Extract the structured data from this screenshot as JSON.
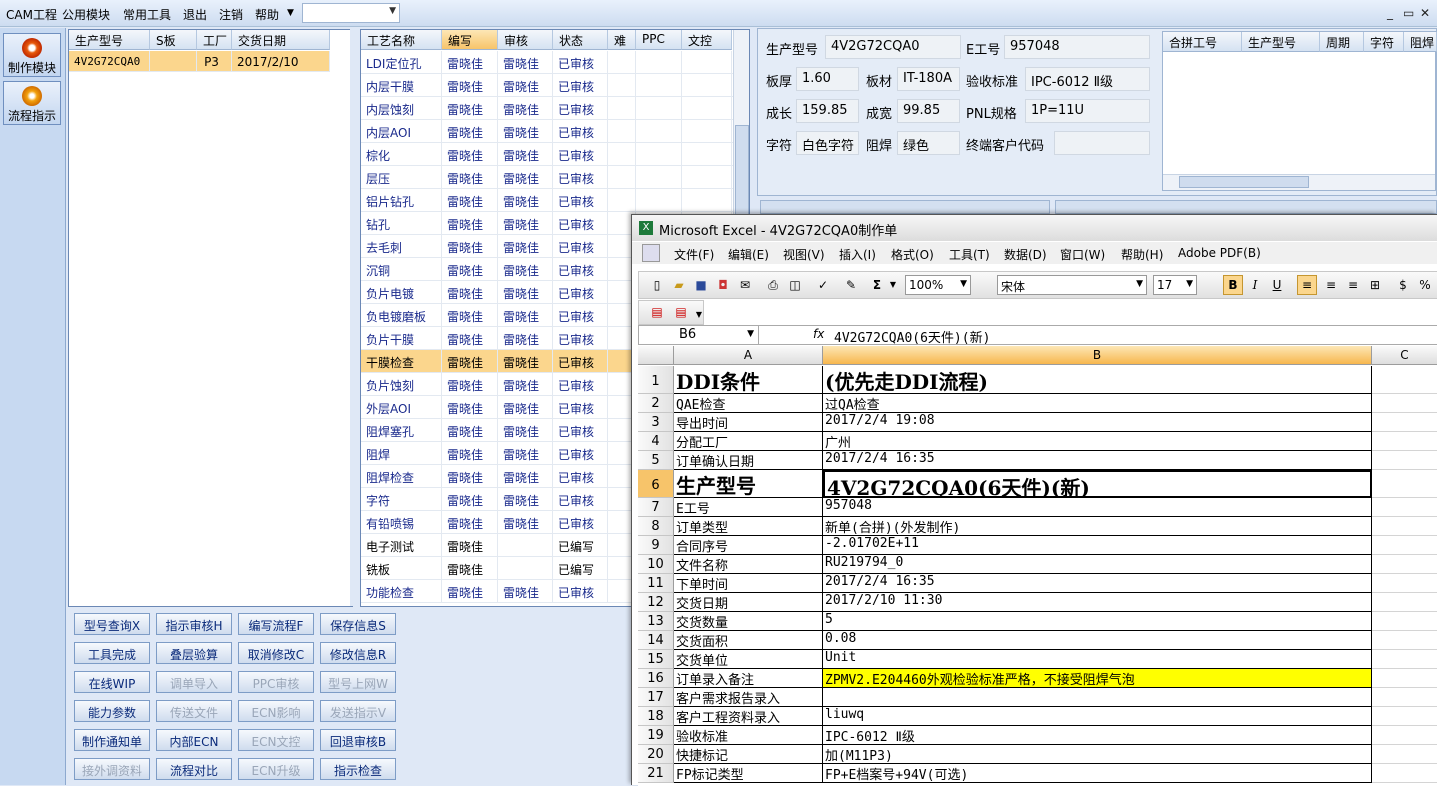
{
  "menu": {
    "items": [
      "CAM工程",
      "公用模块",
      "常用工具",
      "退出",
      "注销",
      "帮助"
    ],
    "win_controls": [
      "_",
      "▭",
      "✕"
    ]
  },
  "nav": {
    "items": [
      {
        "label": "制作模块",
        "icon": "flame-icon"
      },
      {
        "label": "流程指示",
        "icon": "flow-icon"
      }
    ]
  },
  "orders": {
    "headers": [
      "生产型号",
      "S板",
      "工厂",
      "交货日期"
    ],
    "rows": [
      [
        "4V2G72CQA0",
        "",
        "P3",
        "2017/2/10"
      ]
    ]
  },
  "process": {
    "headers": [
      "工艺名称",
      "编写",
      "审核",
      "状态",
      "难",
      "PPC",
      "文控"
    ],
    "rows": [
      [
        "LDI定位孔",
        "雷晓佳",
        "雷晓佳",
        "已审核"
      ],
      [
        "内层干膜",
        "雷晓佳",
        "雷晓佳",
        "已审核"
      ],
      [
        "内层蚀刻",
        "雷晓佳",
        "雷晓佳",
        "已审核"
      ],
      [
        "内层AOI",
        "雷晓佳",
        "雷晓佳",
        "已审核"
      ],
      [
        "棕化",
        "雷晓佳",
        "雷晓佳",
        "已审核"
      ],
      [
        "层压",
        "雷晓佳",
        "雷晓佳",
        "已审核"
      ],
      [
        "铝片钻孔",
        "雷晓佳",
        "雷晓佳",
        "已审核"
      ],
      [
        "钻孔",
        "雷晓佳",
        "雷晓佳",
        "已审核"
      ],
      [
        "去毛刺",
        "雷晓佳",
        "雷晓佳",
        "已审核"
      ],
      [
        "沉铜",
        "雷晓佳",
        "雷晓佳",
        "已审核"
      ],
      [
        "负片电镀",
        "雷晓佳",
        "雷晓佳",
        "已审核"
      ],
      [
        "负电镀磨板",
        "雷晓佳",
        "雷晓佳",
        "已审核"
      ],
      [
        "负片干膜",
        "雷晓佳",
        "雷晓佳",
        "已审核"
      ],
      [
        "干膜检查",
        "雷晓佳",
        "雷晓佳",
        "已审核"
      ],
      [
        "负片蚀刻",
        "雷晓佳",
        "雷晓佳",
        "已审核"
      ],
      [
        "外层AOI",
        "雷晓佳",
        "雷晓佳",
        "已审核"
      ],
      [
        "阻焊塞孔",
        "雷晓佳",
        "雷晓佳",
        "已审核"
      ],
      [
        "阻焊",
        "雷晓佳",
        "雷晓佳",
        "已审核"
      ],
      [
        "阻焊检查",
        "雷晓佳",
        "雷晓佳",
        "已审核"
      ],
      [
        "字符",
        "雷晓佳",
        "雷晓佳",
        "已审核"
      ],
      [
        "有铅喷锡",
        "雷晓佳",
        "雷晓佳",
        "已审核"
      ],
      [
        "电子测试",
        "雷晓佳",
        "",
        "已编写"
      ],
      [
        "铣板",
        "雷晓佳",
        "",
        "已编写"
      ],
      [
        "功能检查",
        "雷晓佳",
        "雷晓佳",
        "已审核"
      ]
    ]
  },
  "buttons": [
    [
      "型号查询X",
      "指示审核H",
      "编写流程F",
      "保存信息S"
    ],
    [
      "工具完成",
      "叠层验算",
      "取消修改C",
      "修改信息R"
    ],
    [
      "在线WIP",
      "调单导入",
      "PPC审核",
      "型号上网W"
    ],
    [
      "能力参数",
      "传送文件",
      "ECN影响",
      "发送指示V"
    ],
    [
      "制作通知单",
      "内部ECN",
      "ECN文控",
      "回退审核B"
    ],
    [
      "接外调资料",
      "流程对比",
      "ECN升级",
      "指示检查"
    ]
  ],
  "info": {
    "model_label": "生产型号",
    "model": "4V2G72CQA0",
    "e_label": "E工号",
    "e_no": "957048",
    "thick_label": "板厚",
    "thick": "1.60",
    "mat_label": "板材",
    "mat": "IT-180A",
    "std_label": "验收标准",
    "std": "IPC-6012 Ⅱ级",
    "len_label": "成长",
    "len": "159.85",
    "wid_label": "成宽",
    "wid": "99.85",
    "pnl_label": "PNL规格",
    "pnl": "1P=11U",
    "char_label": "字符",
    "char": "白色字符",
    "mask_label": "阻焊",
    "mask": "绿色",
    "cust_label": "终端客户代码",
    "cust": "",
    "merge_headers": [
      "合拼工号",
      "生产型号",
      "周期",
      "字符",
      "阻焊"
    ]
  },
  "excel": {
    "title": "Microsoft Excel - 4V2G72CQA0制作单",
    "menu": [
      "文件(F)",
      "编辑(E)",
      "视图(V)",
      "插入(I)",
      "格式(O)",
      "工具(T)",
      "数据(D)",
      "窗口(W)",
      "帮助(H)",
      "Adobe PDF(B)"
    ],
    "zoom": "100%",
    "font": "宋体",
    "size": "17",
    "namebox": "B6",
    "formula": "4V2G72CQA0(6天件)(新)",
    "cols": [
      "A",
      "B",
      "C"
    ],
    "rows": [
      [
        "1",
        "DDI条件",
        "(优先走DDI流程)"
      ],
      [
        "2",
        "QAE检查",
        "过QA检查"
      ],
      [
        "3",
        "导出时间",
        "2017/2/4 19:08"
      ],
      [
        "4",
        "分配工厂",
        "广州"
      ],
      [
        "5",
        "订单确认日期",
        "2017/2/4 16:35"
      ],
      [
        "6",
        "生产型号",
        "4V2G72CQA0(6天件)(新)"
      ],
      [
        "7",
        "E工号",
        "957048"
      ],
      [
        "8",
        "订单类型",
        "新单(合拼)(外发制作)"
      ],
      [
        "9",
        "合同序号",
        "-2.01702E+11"
      ],
      [
        "10",
        "文件名称",
        "RU219794_0"
      ],
      [
        "11",
        "下单时间",
        "2017/2/4 16:35"
      ],
      [
        "12",
        "交货日期",
        "2017/2/10 11:30"
      ],
      [
        "13",
        "交货数量",
        "5"
      ],
      [
        "14",
        "交货面积",
        "0.08"
      ],
      [
        "15",
        "交货单位",
        "Unit"
      ],
      [
        "16",
        "订单录入备注",
        "ZPMV2.E204460外观检验标准严格，不接受阻焊气泡"
      ],
      [
        "17",
        "客户需求报告录入",
        ""
      ],
      [
        "18",
        "客户工程资料录入",
        "liuwq"
      ],
      [
        "19",
        "验收标准",
        "IPC-6012 Ⅱ级"
      ],
      [
        "20",
        "快捷标记",
        "加(M11P3)"
      ],
      [
        "21",
        "FP标记类型",
        "FP+E档案号+94V(可选)"
      ]
    ]
  }
}
